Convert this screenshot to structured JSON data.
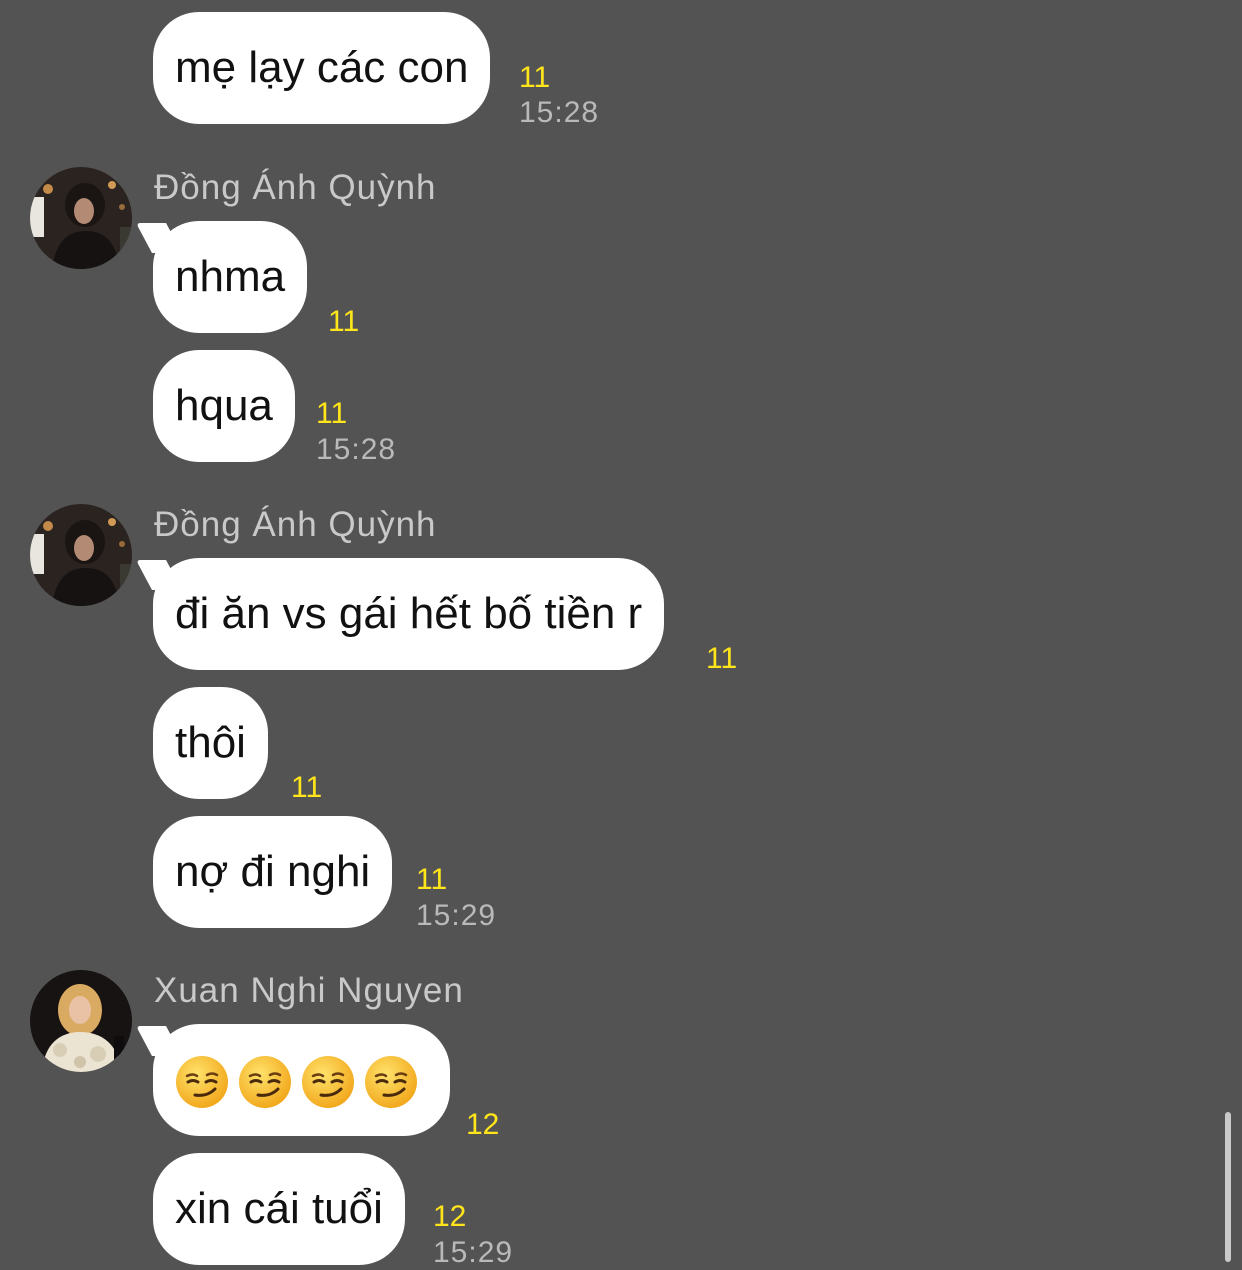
{
  "colors": {
    "background": "#545353",
    "bubble": "#ffffff",
    "read_count": "#ffe51a",
    "timestamp": "#b9b9b9",
    "sender_name": "#c9c9c9"
  },
  "messages": [
    {
      "text": "mẹ lạy các con",
      "read_count": "11",
      "time": "15:28"
    },
    {
      "sender": "Đồng Ánh Quỳnh",
      "avatar": "avatar-photo-woman-dark-hair"
    },
    {
      "text": "nhma",
      "read_count": "11"
    },
    {
      "text": "hqua",
      "read_count": "11",
      "time": "15:28"
    },
    {
      "sender": "Đồng Ánh Quỳnh",
      "avatar": "avatar-photo-woman-dark-hair"
    },
    {
      "text": "đi ăn vs gái hết bố tiền r",
      "read_count": "11"
    },
    {
      "text": "thôi",
      "read_count": "11"
    },
    {
      "text": "nợ đi nghi",
      "read_count": "11",
      "time": "15:29"
    },
    {
      "sender": "Xuan Nghi Nguyen",
      "avatar": "avatar-photo-woman-blonde-fur-coat"
    },
    {
      "emoji": [
        "smirking-face-emoji",
        "smirking-face-emoji",
        "smirking-face-emoji",
        "smirking-face-emoji"
      ],
      "read_count": "12"
    },
    {
      "text": "xin cái tuổi",
      "read_count": "12",
      "time": "15:29"
    }
  ]
}
